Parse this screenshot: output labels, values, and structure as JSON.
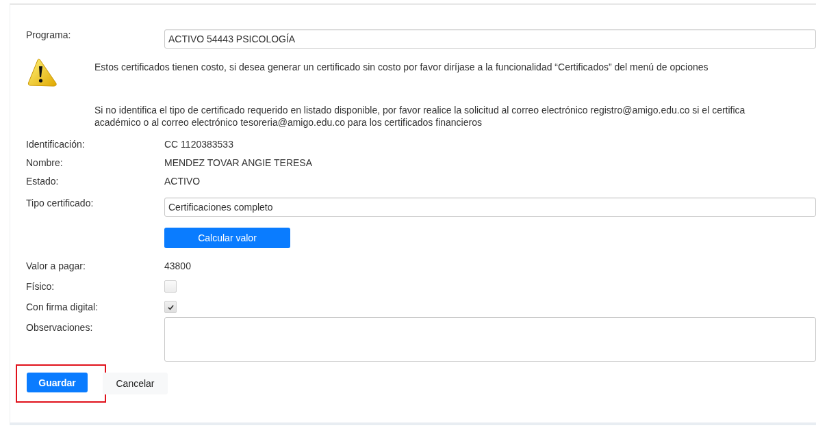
{
  "program": {
    "label": "Programa:",
    "value": "ACTIVO 54443 PSICOLOGÍA"
  },
  "notices": [
    {
      "kind": "warning",
      "lines": [
        "Estos certificados tienen costo, si desea generar un certificado sin costo por favor diríjase a la funcionalidad “Certificados” del menú de opciones"
      ]
    },
    {
      "kind": "info",
      "lines": [
        "Si no identifica el tipo de certificado requerido en listado disponible, por favor realice la solicitud al correo electrónico registro@amigo.edu.co si el certifica",
        "académico o al correo electrónico tesoreria@amigo.edu.co para los certificados financieros"
      ]
    }
  ],
  "details": [
    {
      "label": "Identificación:",
      "value": "CC 1120383533"
    },
    {
      "label": "Nombre:",
      "value": "MENDEZ TOVAR ANGIE TERESA"
    },
    {
      "label": "Estado:",
      "value": "ACTIVO"
    }
  ],
  "certificate_type": {
    "label": "Tipo certificado:",
    "value": "Certificaciones completo"
  },
  "calculate_button": "Calcular valor",
  "amount": {
    "label": "Valor a pagar:",
    "value": "43800"
  },
  "options": [
    {
      "label": "Físico:",
      "checked": false
    },
    {
      "label": "Con firma digital:",
      "checked": true
    }
  ],
  "observations": {
    "label": "Observaciones:"
  },
  "actions": [
    {
      "label": "Guardar",
      "kind": "primary",
      "highlighted": true
    },
    {
      "label": "Cancelar",
      "kind": "secondary",
      "highlighted": false
    }
  ]
}
